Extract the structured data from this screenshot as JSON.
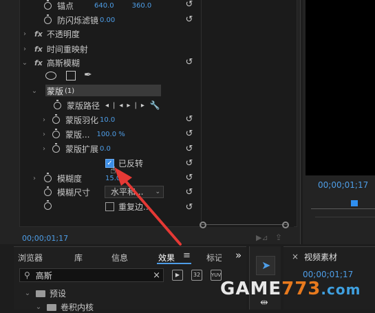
{
  "effect_controls": {
    "anchor": {
      "label": "锚点",
      "x": "640.0",
      "y": "360.0"
    },
    "antiflicker": {
      "label": "防闪烁滤镜",
      "value": "0.00"
    },
    "opacity": {
      "label": "不透明度"
    },
    "time_remap": {
      "label": "时间重映射"
    },
    "gaussian_blur": {
      "label": "高斯模糊"
    },
    "mask": {
      "label": "蒙版",
      "count": "(1)"
    },
    "mask_path": {
      "label": "蒙版路径"
    },
    "mask_feather": {
      "label": "蒙版羽化",
      "value": "10.0"
    },
    "mask_opacity": {
      "label": "蒙版...",
      "value": "100.0 %"
    },
    "mask_expansion": {
      "label": "蒙版扩展",
      "value": "0.0"
    },
    "inverted": {
      "label": "已反转",
      "checked": true
    },
    "blurriness": {
      "label": "模糊度",
      "value": "15.0"
    },
    "blur_dimensions": {
      "label": "模糊尺寸",
      "value": "水平和..."
    },
    "repeat_edge": {
      "label": "重复边...",
      "checked": false
    },
    "fx_symbol": "fx",
    "timecode": "00;00;01;17"
  },
  "program": {
    "timecode": "00;00;01;17"
  },
  "bottom": {
    "tabs": [
      "浏览器",
      "库",
      "信息",
      "效果",
      "标记"
    ],
    "active_tab": "效果",
    "more": "»",
    "search_value": "高斯",
    "tree": [
      {
        "label": "预设"
      },
      {
        "label": "卷积内核"
      }
    ],
    "tool_icons": [
      "32",
      "YUV"
    ]
  },
  "source": {
    "close": "×",
    "title": "视频素材",
    "timecode": "00;00;01;17"
  },
  "watermark": {
    "text": "GAME773.com"
  },
  "colors": {
    "accent": "#4e9ee8",
    "arrow": "#e53935"
  }
}
